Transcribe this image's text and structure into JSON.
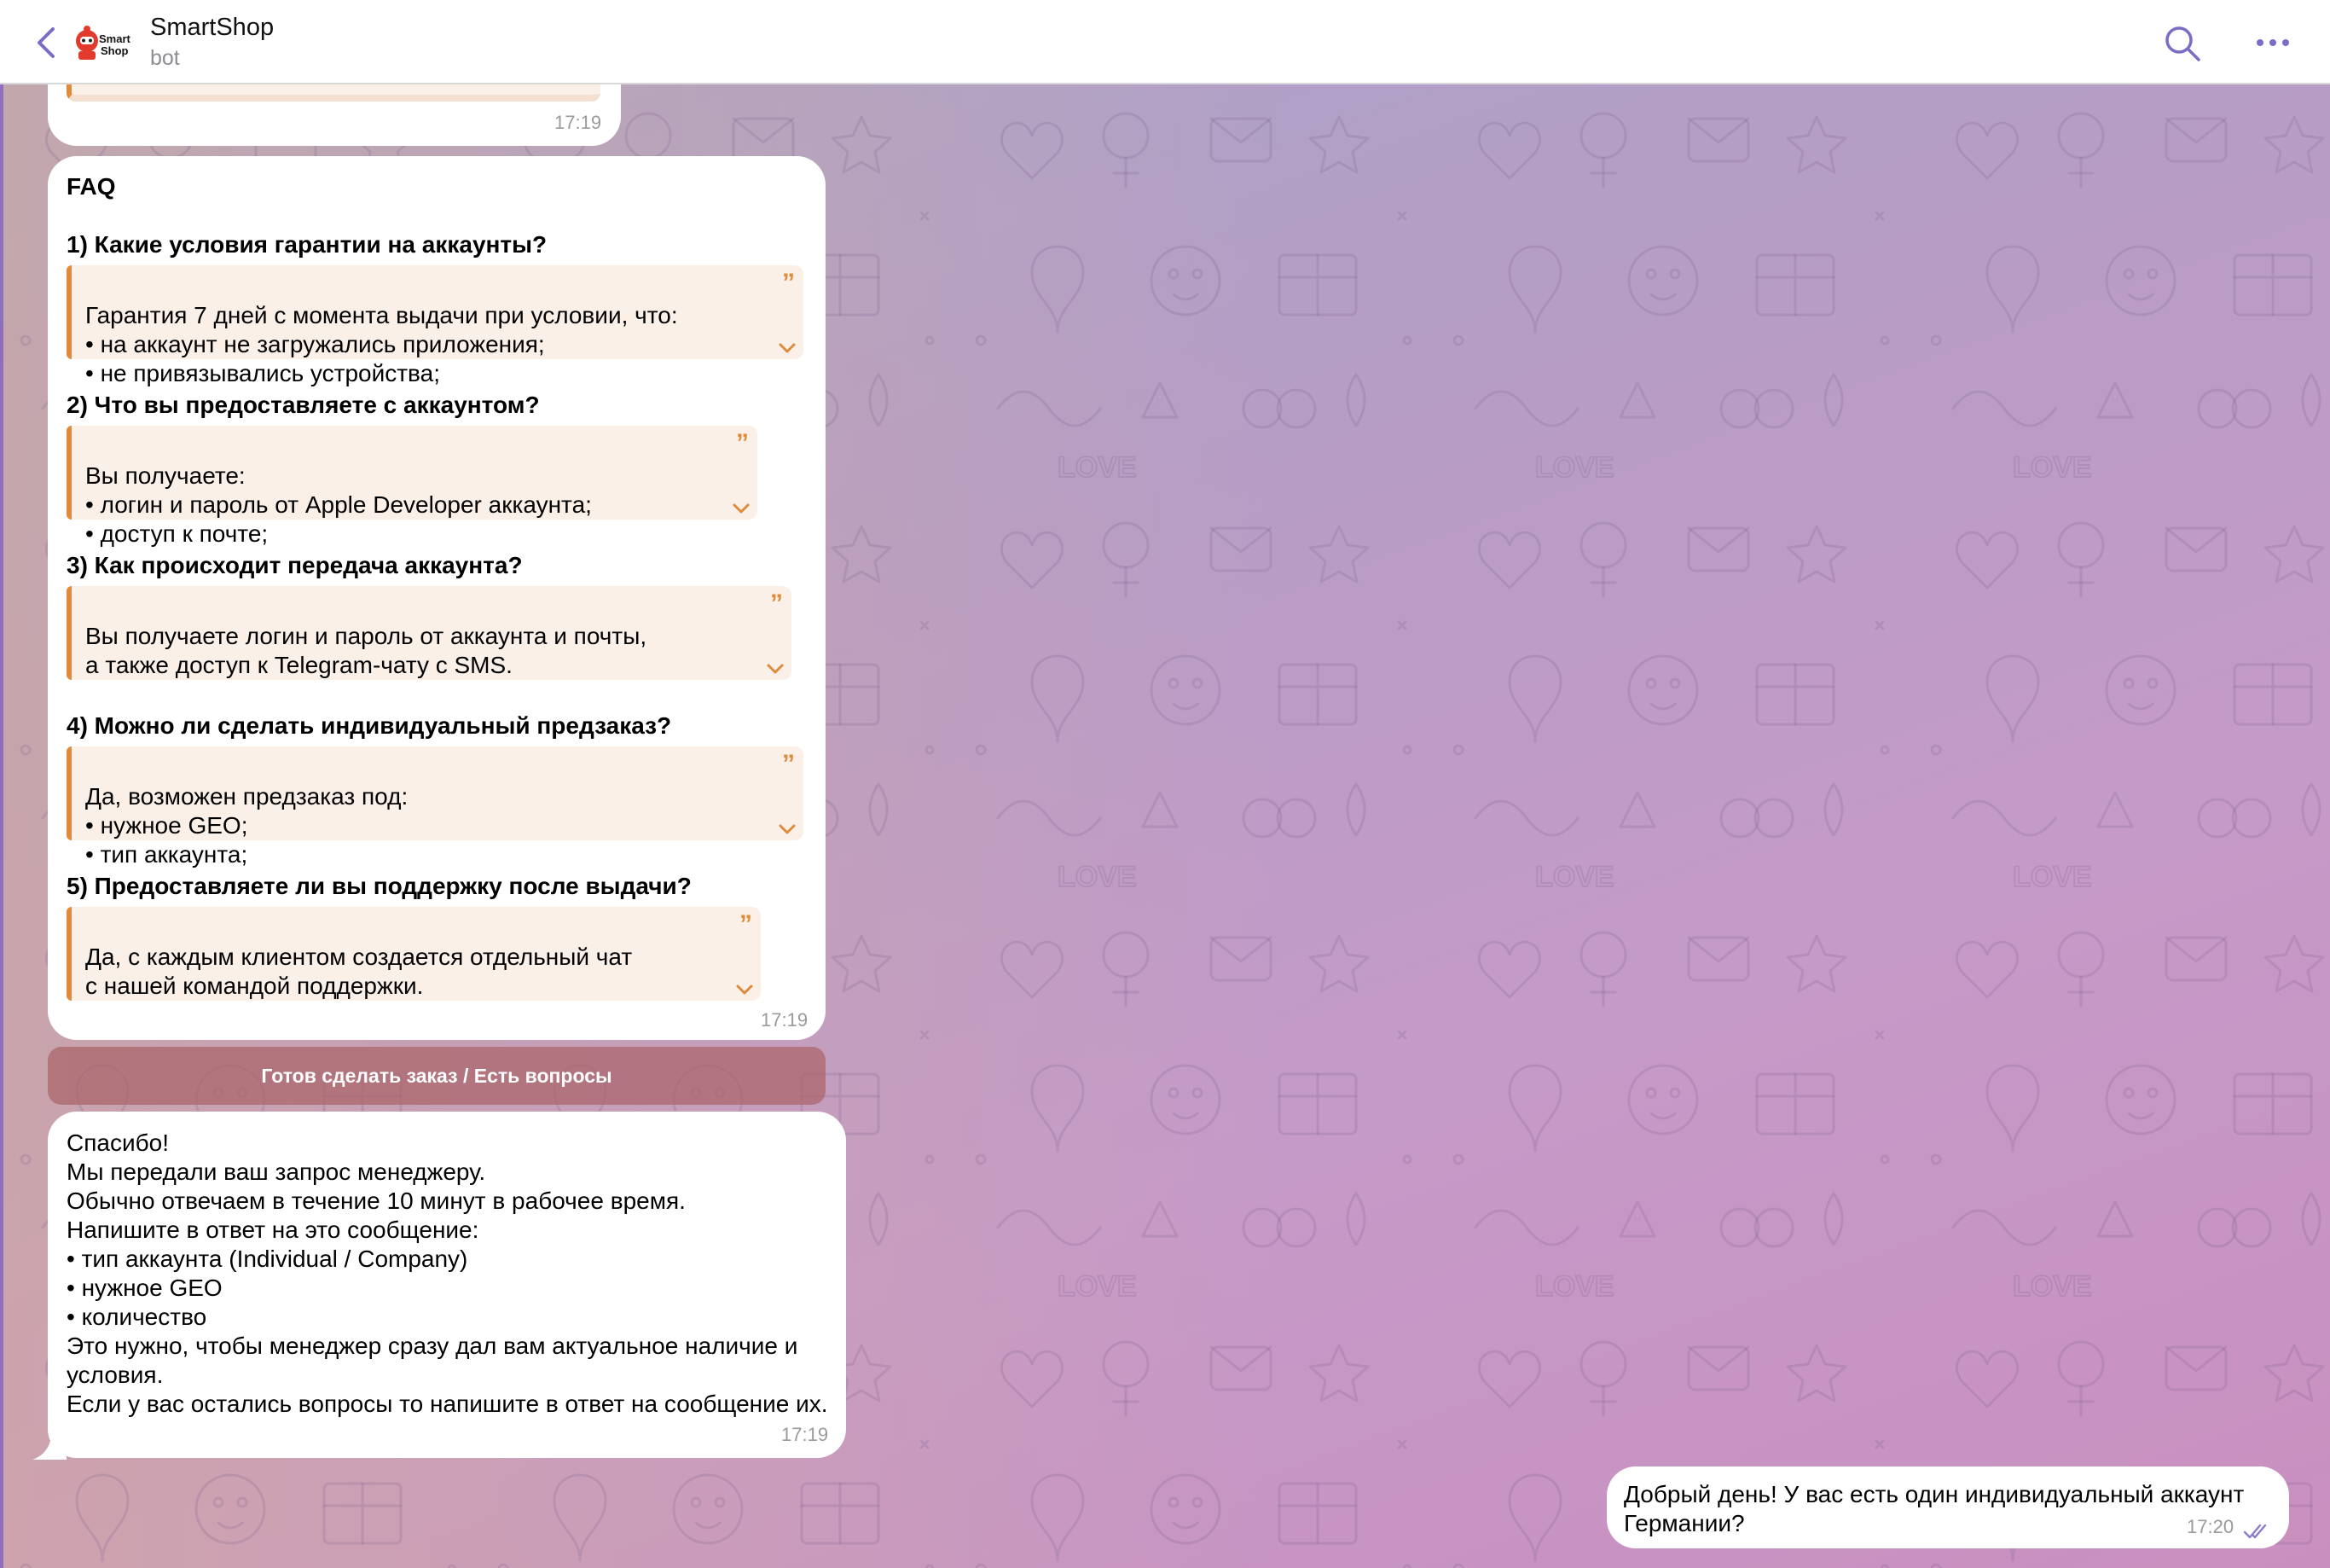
{
  "header": {
    "title": "SmartShop",
    "subtitle": "bot",
    "logo_text": "Smart Shop",
    "icons": [
      "chevron-left-icon",
      "smartshop-logo",
      "search-icon",
      "more-icon"
    ],
    "accent_color": "#7b6cc6"
  },
  "messages": {
    "previous": {
      "time": "17:19"
    },
    "faq": {
      "title": "FAQ",
      "items": [
        {
          "question": "1) Какие условия гарантии на аккаунты?",
          "answer": "Гарантия 7 дней с момента выдачи при условии, что:\n• на аккаунт не загружались приложения;\n• не привязывались устройства;"
        },
        {
          "question": "2) Что вы предоставляете с аккаунтом?",
          "answer": "Вы получаете:\n• логин и пароль от Apple Developer аккаунта;\n• доступ к почте;"
        },
        {
          "question": "3) Как происходит передача аккаунта?",
          "answer": "Вы получаете логин и пароль от аккаунта и почты,\nа также доступ к Telegram-чату с SMS."
        },
        {
          "question": "4) Можно ли сделать индивидуальный предзаказ?",
          "answer": "Да, возможен предзаказ под:\n• нужное GEO;\n• тип аккаунта;"
        },
        {
          "question": "5) Предоставляете ли вы поддержку после выдачи?",
          "answer": "Да, с каждым клиентом создается отдельный чат\nс нашей командой поддержки."
        }
      ],
      "time": "17:19"
    },
    "keyboard_button": "Готов сделать заказ / Есть вопросы",
    "thanks": {
      "text": "Спасибо!\nМы передали ваш запрос менеджеру.\nОбычно отвечаем в течение 10 минут в рабочее время.\nНапишите в ответ на это сообщение:\n• тип аккаунта (Individual / Company)\n• нужное GEO\n• количество\nЭто нужно, чтобы менеджер сразу дал вам актуальное наличие и условия.\nЕсли у вас остались вопросы то напишите в ответ на сообщение их.",
      "time": "17:19"
    },
    "outgoing": {
      "text": "Добрый день! У вас есть один индивидуальный аккаунт Германии?",
      "time": "17:20",
      "status": "read"
    }
  },
  "colors": {
    "quote_bar": "#e08a3c",
    "quote_bg": "#faf0e8",
    "bubble_bg": "#ffffff",
    "keyboard_button_bg": "#b06a6e"
  }
}
